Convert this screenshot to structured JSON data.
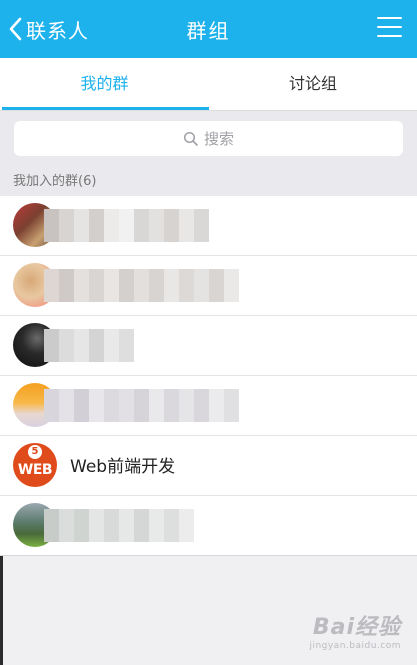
{
  "navbar": {
    "back_label": "联系人",
    "title": "群组",
    "color": "#1eb2ec"
  },
  "tabs": [
    {
      "label": "我的群",
      "active": true
    },
    {
      "label": "讨论组",
      "active": false
    }
  ],
  "search": {
    "placeholder": "搜索",
    "icon": "search-icon"
  },
  "section": {
    "header": "我加入的群(6)"
  },
  "groups": [
    {
      "name": "",
      "blurred": true
    },
    {
      "name": "",
      "blurred": true
    },
    {
      "name": "",
      "blurred": true
    },
    {
      "name": "",
      "blurred": true
    },
    {
      "name": "Web前端开发",
      "blurred": false,
      "avatar_text": "WEB",
      "avatar_badge": "5",
      "avatar_color": "#e04b1c"
    },
    {
      "name": "",
      "blurred": true
    }
  ],
  "watermark": {
    "brand": "Bai经验",
    "sub": "jingyan.baidu.com"
  }
}
